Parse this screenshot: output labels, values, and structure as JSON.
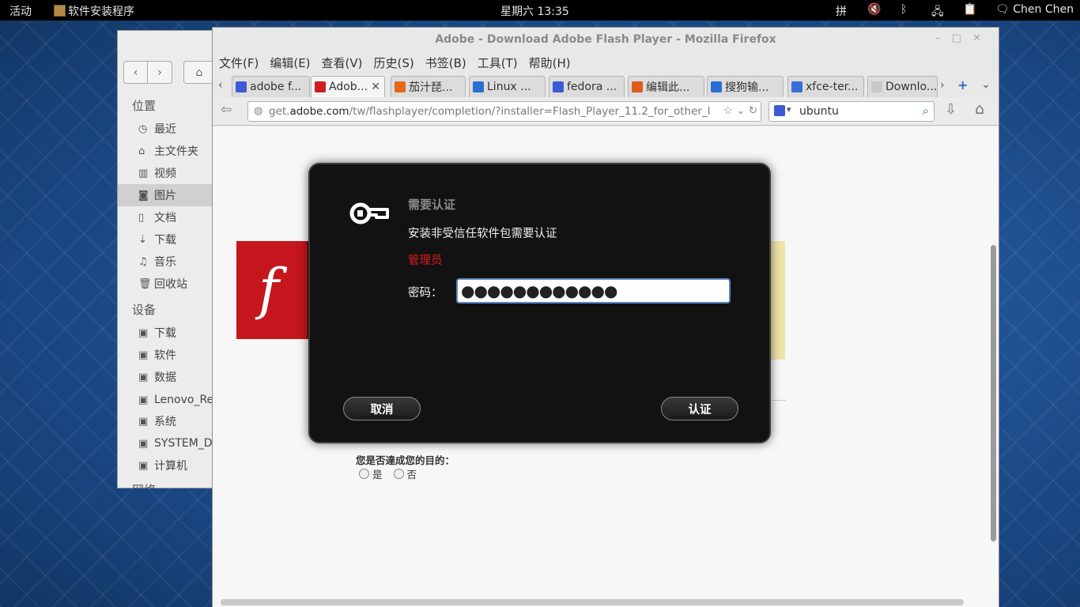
{
  "topbar": {
    "activities": "活动",
    "app_name": "软件安装程序",
    "clock": "星期六 13:35",
    "input_method": "拼",
    "user": "Chen Chen"
  },
  "nautilus": {
    "places_header": "位置",
    "places": [
      {
        "label": "最近",
        "icon": "clock-icon"
      },
      {
        "label": "主文件夹",
        "icon": "home-icon"
      },
      {
        "label": "视频",
        "icon": "film-icon"
      },
      {
        "label": "图片",
        "icon": "camera-icon",
        "selected": true
      },
      {
        "label": "文档",
        "icon": "document-icon"
      },
      {
        "label": "下载",
        "icon": "download-icon"
      },
      {
        "label": "音乐",
        "icon": "music-icon"
      },
      {
        "label": "回收站",
        "icon": "trash-icon"
      }
    ],
    "devices_header": "设备",
    "devices": [
      "下载",
      "软件",
      "数据",
      "Lenovo_Re",
      "系统",
      "SYSTEM_DI",
      "计算机"
    ],
    "network_header": "网络"
  },
  "firefox": {
    "title": "Adobe - Download Adobe Flash Player - Mozilla Firefox",
    "menu": [
      "文件(F)",
      "编辑(E)",
      "查看(V)",
      "历史(S)",
      "书签(B)",
      "工具(T)",
      "帮助(H)"
    ],
    "tabs": [
      {
        "label": "adobe f...",
        "color": "#3b5bd6"
      },
      {
        "label": "Adob...",
        "color": "#cc1f1f",
        "active": true
      },
      {
        "label": "茄汁琵...",
        "color": "#e06a1a"
      },
      {
        "label": "Linux ...",
        "color": "#2a6fd0"
      },
      {
        "label": "fedora ...",
        "color": "#3b5bd6"
      },
      {
        "label": "编辑此...",
        "color": "#e05a1a"
      },
      {
        "label": "搜狗输...",
        "color": "#2a6fd0"
      },
      {
        "label": "xfce-ter...",
        "color": "#3a6fd8"
      },
      {
        "label": "Downlo...",
        "color": "#c9c9c9"
      }
    ],
    "url_prefix": "get.",
    "url_domain": "adobe.com",
    "url_rest": "/tw/flashplayer/completion/?installer=Flash_Player_11.2_for_other_l",
    "search_value": "ubuntu"
  },
  "page": {
    "survey_question": "您是否達成您的目的：",
    "yes": "是",
    "no": "否"
  },
  "auth": {
    "title": "需要认证",
    "message": "安装非受信任软件包需要认证",
    "user": "管理员",
    "password_label": "密码：",
    "password_value": "●●●●●●●●●●●●",
    "cancel_label": "取消",
    "confirm_label": "认证"
  }
}
